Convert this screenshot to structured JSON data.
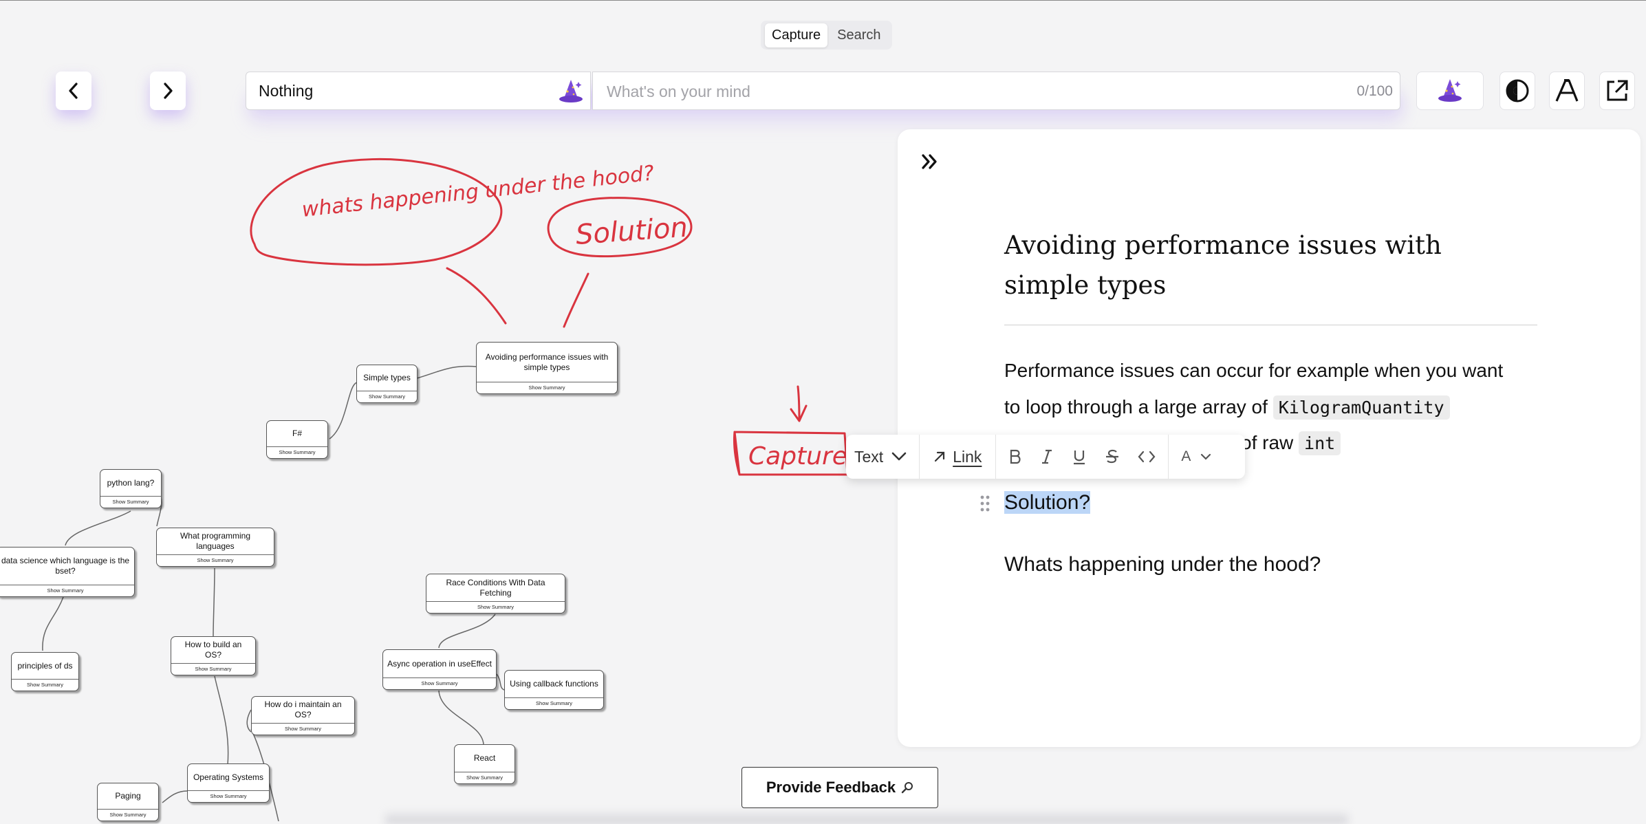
{
  "header": {
    "tabs": [
      {
        "label": "Capture",
        "active": true
      },
      {
        "label": "Search",
        "active": false
      }
    ],
    "topic_value": "Nothing",
    "thought_placeholder": "What's on your mind",
    "char_counter": "0/100"
  },
  "colors": {
    "accent_purple": "#7b4bd8",
    "annotation_red": "#d9343f",
    "selection_blue": "#bcd6f7"
  },
  "nodes": [
    {
      "title": "Avoiding performance issues with simple types",
      "summary": "Show Summary"
    },
    {
      "title": "Simple types",
      "summary": "Show Summary"
    },
    {
      "title": "F#",
      "summary": "Show Summary"
    },
    {
      "title": "python lang?",
      "summary": "Show Summary"
    },
    {
      "title": "What programming languages",
      "summary": "Show Summary"
    },
    {
      "title": "data science which language is the bset?",
      "summary": "Show Summary"
    },
    {
      "title": "principles of ds",
      "summary": "Show Summary"
    },
    {
      "title": "How to build an OS?",
      "summary": "Show Summary"
    },
    {
      "title": "How do i maintain an OS?",
      "summary": "Show Summary"
    },
    {
      "title": "Operating Systems",
      "summary": "Show Summary"
    },
    {
      "title": "Paging",
      "summary": "Show Summary"
    },
    {
      "title": "Race Conditions With Data Fetching",
      "summary": "Show Summary"
    },
    {
      "title": "Async operation in useEffect",
      "summary": "Show Summary"
    },
    {
      "title": "Using callback functions",
      "summary": "Show Summary"
    },
    {
      "title": "React",
      "summary": "Show Summary"
    }
  ],
  "annotations": {
    "bubble1": "whats happening under the hood?",
    "bubble2": "Solution",
    "capture": "Capture"
  },
  "panel": {
    "title": "Avoiding performance issues with simple types",
    "para_line1": "Performance issues can occur for example when you want",
    "para_line2_pre": "to loop through a large array of ",
    "code1": "KilogramQuantity",
    "para_line3_post": "y of raw ",
    "code2": "int",
    "heading_solution": "Solution?",
    "heading_hood": "Whats happening under the hood?"
  },
  "toolbar": {
    "text_style": "Text",
    "link": "Link",
    "color_label": "A"
  },
  "feedback_label": "Provide Feedback",
  "icons": [
    "chevron-left-icon",
    "chevron-right-icon",
    "wizard-hat-icon",
    "contrast-icon",
    "font-icon",
    "external-link-icon",
    "double-chevron-right-icon",
    "drag-handle-icon",
    "bold-icon",
    "italic-icon",
    "underline-icon",
    "strikethrough-icon",
    "code-icon",
    "magnifier-icon"
  ]
}
